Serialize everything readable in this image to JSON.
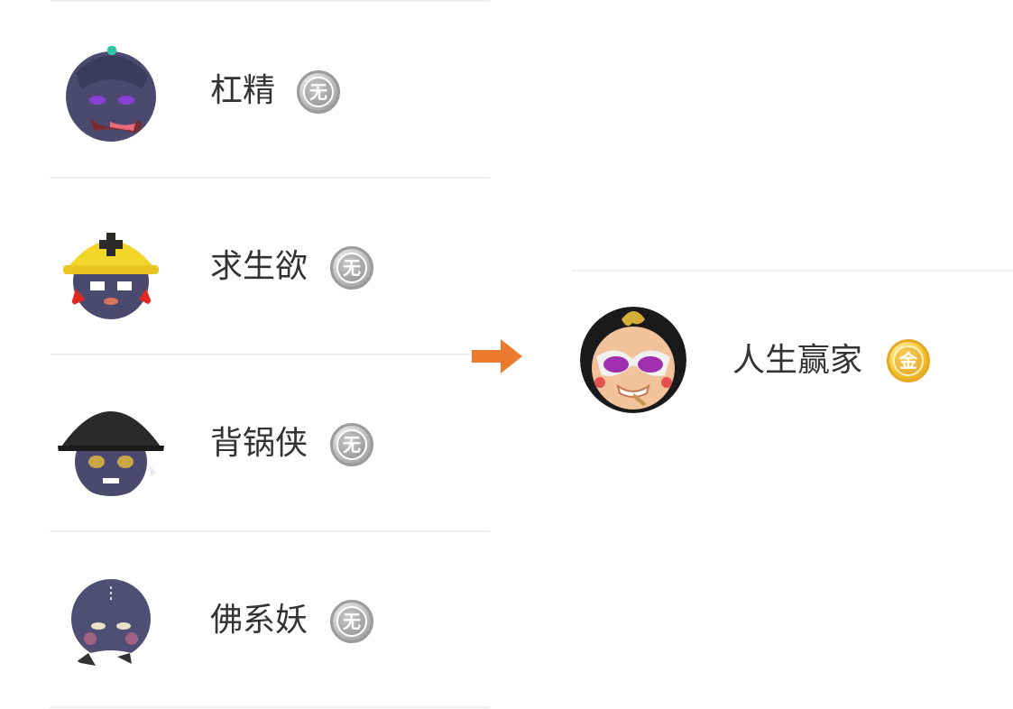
{
  "before": {
    "items": [
      {
        "name": "杠精",
        "badge": "无",
        "avatar_icon": "purple-imp-tongue-avatar"
      },
      {
        "name": "求生欲",
        "badge": "无",
        "avatar_icon": "purple-imp-hardhat-avatar"
      },
      {
        "name": "背锅侠",
        "badge": "无",
        "avatar_icon": "purple-imp-wok-avatar"
      },
      {
        "name": "佛系妖",
        "badge": "无",
        "avatar_icon": "purple-imp-monk-avatar"
      }
    ]
  },
  "transition": {
    "icon": "arrow-right-icon",
    "color": "#ec7a2e"
  },
  "after": {
    "name": "人生赢家",
    "badge": "金",
    "avatar_icon": "baby-sunglasses-avatar"
  },
  "colors": {
    "silver_badge": "#9b9b9b",
    "gold_badge": "#f2b92c",
    "text": "#333333"
  }
}
